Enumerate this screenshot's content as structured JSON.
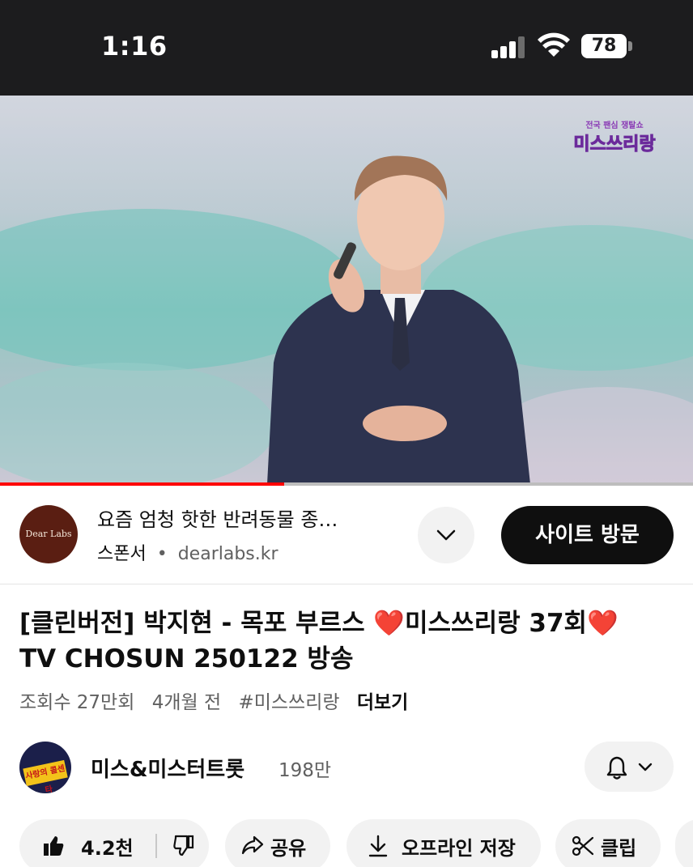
{
  "status_bar": {
    "time": "1:16",
    "battery": "78"
  },
  "video": {
    "show_logo_top": "전국 팬심 쟁탈쇼",
    "show_logo_main": "미스쓰리랑",
    "progress_fraction": 0.41
  },
  "ad": {
    "logo_text": "Dear Labs",
    "title": "요즘 엄청 핫한 반려동물 종…",
    "sponsor_label": "스폰서",
    "separator": "•",
    "domain": "dearlabs.kr",
    "cta_label": "사이트 방문"
  },
  "title": {
    "part1": "[클린버전] 박지현 - 목포 부르스 ",
    "heart1": "❤️",
    "part2": "미스쓰리랑 37회",
    "heart2": "❤️",
    "part3": "TV CHOSUN 250122 방송"
  },
  "meta": {
    "views": "조회수 27만회",
    "age": "4개월 전",
    "hashtag": "#미스쓰리랑",
    "more": "더보기"
  },
  "channel": {
    "name": "미스&미스터트롯",
    "subscribers": "198만",
    "avatar_text": "사랑의 콜센타"
  },
  "actions": {
    "like_count": "4.2천",
    "share": "공유",
    "download": "오프라인 저장",
    "clip": "클립"
  },
  "colors": {
    "accent_red": "#ff0000",
    "chip_bg": "#f2f2f2",
    "cta_bg": "#0f0f0f"
  }
}
